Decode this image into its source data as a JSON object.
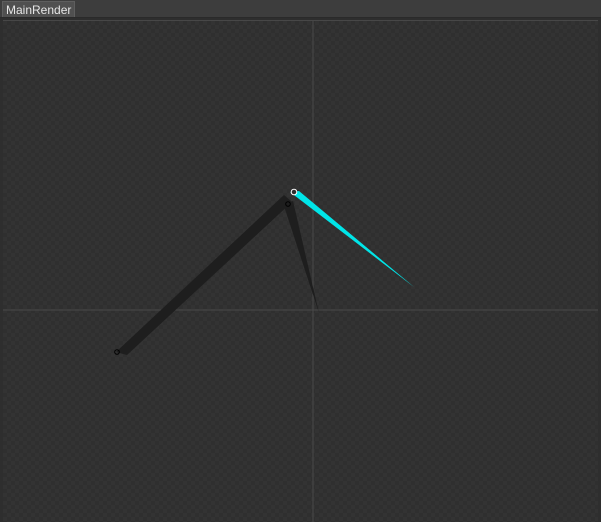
{
  "window": {
    "tab_title": "MainRender"
  },
  "scene": {
    "background_color": "#333333",
    "axis_color": "#4a4a4a",
    "selected_bone_color": "#00e5e8",
    "bone_shadow_color": "#1e1e1e",
    "pivot_color": "#ffffff",
    "joint_color": "#000000"
  }
}
